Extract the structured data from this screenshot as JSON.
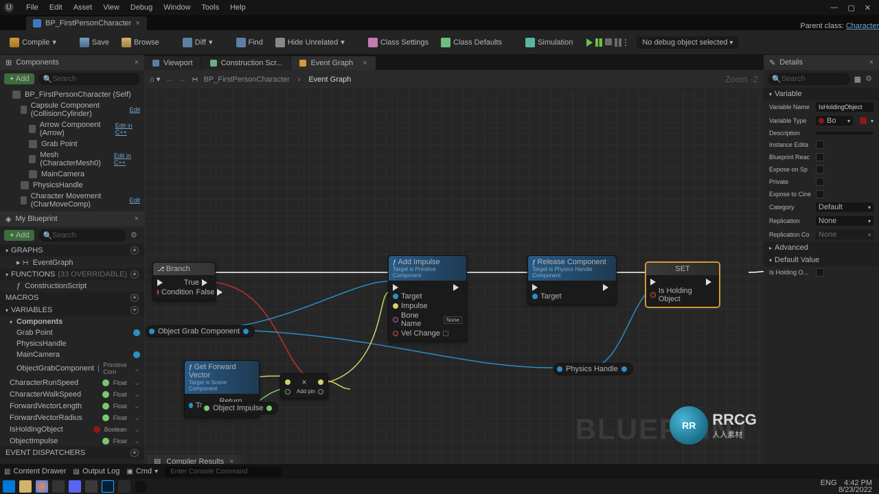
{
  "menus": [
    "File",
    "Edit",
    "Asset",
    "View",
    "Debug",
    "Window",
    "Tools",
    "Help"
  ],
  "doc_tab": {
    "label": "BP_FirstPersonCharacter"
  },
  "parent_class": {
    "label": "Parent class:",
    "link": "Character"
  },
  "toolbar": {
    "compile": "Compile",
    "save": "Save",
    "browse": "Browse",
    "diff": "Diff",
    "find": "Find",
    "hide": "Hide Unrelated",
    "class_settings": "Class Settings",
    "class_defaults": "Class Defaults",
    "simulation": "Simulation",
    "debug": "No debug object selected"
  },
  "panels": {
    "components": "Components",
    "my_blueprint": "My Blueprint",
    "details": "Details",
    "viewport": "Viewport",
    "construction": "Construction Scr...",
    "event_graph": "Event Graph",
    "compiler": "Compiler Results"
  },
  "add": "Add",
  "search_ph": "Search",
  "components_tree": {
    "root": "BP_FirstPersonCharacter (Self)",
    "capsule": "Capsule Component (CollisionCylinder)",
    "arrow": "Arrow Component (Arrow)",
    "grab": "Grab Point",
    "mesh": "Mesh (CharacterMesh0)",
    "camera": "MainCamera",
    "physics": "PhysicsHandle",
    "charmove": "Character Movement (CharMoveComp)",
    "edit": "Edit",
    "editcpp": "Edit in C++"
  },
  "bp_sections": {
    "graphs": "GRAPHS",
    "functions": "FUNCTIONS",
    "func_ov": "(33 OVERRIDABLE)",
    "macros": "MACROS",
    "variables": "VARIABLES",
    "components": "Components",
    "dispatchers": "EVENT DISPATCHERS"
  },
  "bp_items": {
    "eventgraph": "EventGraph",
    "construction": "ConstructionScript",
    "grab": "Grab Point",
    "physics": "PhysicsHandle",
    "camera": "MainCamera",
    "ogc": "ObjectGrabComponent",
    "ogc_type": "Primitive Com",
    "run": "CharacterRunSpeed",
    "walk": "CharacterWalkSpeed",
    "fvl": "ForwardVectorLength",
    "fvr": "ForwardVectorRadius",
    "hold": "IsHoldingObject",
    "imp": "ObjectImpulse",
    "float": "Float",
    "boolean": "Boolean"
  },
  "breadcrumb": {
    "asset": "BP_FirstPersonCharacter",
    "graph": "Event Graph",
    "zoom": "Zoom -2"
  },
  "watermark": "BLUEPRINT",
  "nodes": {
    "branch": {
      "title": "Branch",
      "true": "True",
      "false": "False",
      "cond": "Condition"
    },
    "add_impulse": {
      "title": "Add Impulse",
      "sub": "Target is Primitive Component",
      "target": "Target",
      "impulse": "Impulse",
      "bone": "Bone Name",
      "bone_val": "None",
      "velchange": "Vel Change"
    },
    "release": {
      "title": "Release Component",
      "sub": "Target is Physics Handle Component",
      "target": "Target"
    },
    "set": {
      "title": "SET",
      "var": "Is Holding Object"
    },
    "getfwd": {
      "title": "Get Forward Vector",
      "sub": "Target is Scene Component",
      "target": "Target",
      "ret": "Return Value"
    },
    "mult": {
      "title": "×",
      "addpin": "Add pin"
    },
    "ogc": "Object Grab Component",
    "ph": "Physics Handle",
    "oi": "Object Impulse"
  },
  "details": {
    "hdr_variable": "Variable",
    "hdr_default": "Default Value",
    "hdr_advanced": "Advanced",
    "name_lbl": "Variable Name",
    "name_val": "IsHoldingObject",
    "type_lbl": "Variable Type",
    "type_val": "Bo",
    "desc_lbl": "Description",
    "inst_lbl": "Instance Edita",
    "bpr_lbl": "Blueprint Reac",
    "spawn_lbl": "Expose on Sp",
    "priv_lbl": "Private",
    "cine_lbl": "Expose to Cine",
    "cat_lbl": "Category",
    "cat_val": "Default",
    "rep_lbl": "Replication",
    "rep_val": "None",
    "repc_lbl": "Replication Co",
    "repc_val": "None",
    "def_lbl": "Is Holding O..."
  },
  "bottom": {
    "content": "Content Drawer",
    "output": "Output Log",
    "cmd": "Cmd",
    "cmd_ph": "Enter Console Command"
  },
  "clock": {
    "time": "4:42 PM",
    "date": "8/23/2022"
  },
  "tray": {
    "eng": "ENG"
  },
  "rrcg": {
    "logo": "RR",
    "name": "RRCG",
    "sub": "人人素材"
  }
}
